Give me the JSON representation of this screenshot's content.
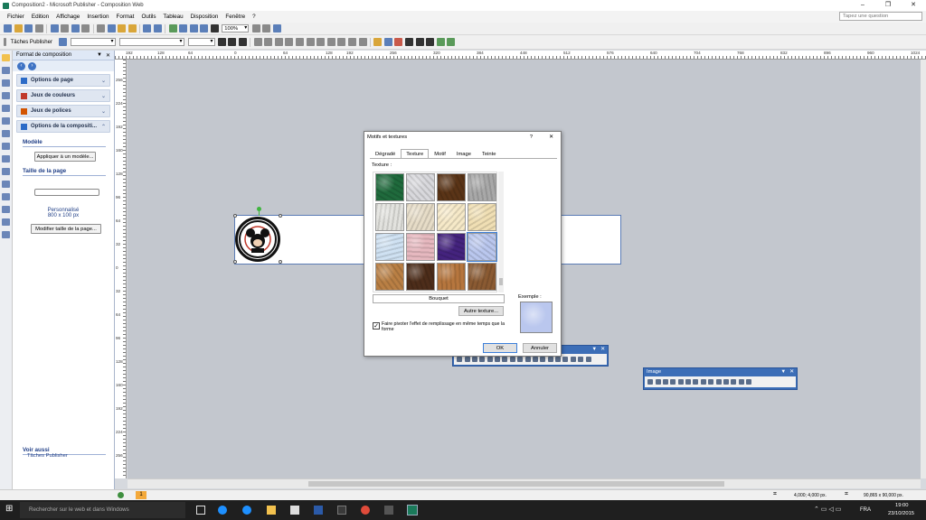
{
  "window": {
    "title": "Composition2 - Microsoft Publisher - Composition Web",
    "controls": [
      "–",
      "❐",
      "✕"
    ]
  },
  "menubar": {
    "items": [
      "Fichier",
      "Edition",
      "Affichage",
      "Insertion",
      "Format",
      "Outils",
      "Tableau",
      "Disposition",
      "Fenêtre",
      "?"
    ],
    "help_placeholder": "Tapez une question"
  },
  "toolbar": {
    "zoom": "100%",
    "task_pane_label": "Tâches Publisher"
  },
  "task_pane": {
    "title": "Format de composition",
    "sections": [
      {
        "label": "Options de page"
      },
      {
        "label": "Jeux de couleurs"
      },
      {
        "label": "Jeux de polices"
      },
      {
        "label": "Options de la compositi..."
      }
    ],
    "model_title": "Modèle",
    "apply_model_button": "Appliquer à un modèle...",
    "page_size_title": "Taille de la page",
    "size_name": "Personnalisé",
    "size_value": "800 x 100 px",
    "modify_size_button": "Modifier taille de la page...",
    "see_also_title": "Voir aussi",
    "see_also_link": "Tâches Publisher"
  },
  "ruler_h": [
    "192",
    "128",
    "64",
    "0",
    "64",
    "128",
    "192",
    "256",
    "320",
    "384",
    "448",
    "512",
    "576",
    "640",
    "704",
    "768",
    "832",
    "896",
    "960",
    "1024",
    "1088",
    "1152",
    "1216",
    "1280",
    "1344"
  ],
  "ruler_v": [
    "256",
    "224",
    "192",
    "160",
    "128",
    "96",
    "64",
    "32",
    "0",
    "32",
    "64",
    "96",
    "128",
    "160",
    "192",
    "224",
    "256",
    "288"
  ],
  "dialog": {
    "title": "Motifs et textures",
    "help": "?",
    "close": "✕",
    "tabs": [
      "Dégradé",
      "Texture",
      "Motif",
      "Image",
      "Teinte"
    ],
    "active_tab": "Texture",
    "texture_label": "Texture :",
    "selected_texture": "Bouquet",
    "other_texture_button": "Autre texture...",
    "example_label": "Exemple :",
    "rotate_checkbox": "Faire pivoter l'effet de remplissage en même temps que la forme",
    "rotate_checked": true,
    "ok_button": "OK",
    "cancel_button": "Annuler",
    "swatches": [
      {
        "name": "Marbre vert",
        "color": "#1f6a3c"
      },
      {
        "name": "Marbre blanc",
        "color": "#d8d8dc"
      },
      {
        "name": "Marbre marron",
        "color": "#5a3417"
      },
      {
        "name": "Granit",
        "color": "#a8a8a8"
      },
      {
        "name": "Papier",
        "color": "#e2e2de"
      },
      {
        "name": "Papyrus",
        "color": "#e6dcc7"
      },
      {
        "name": "Parchemin",
        "color": "#f6e9c8"
      },
      {
        "name": "Sable",
        "color": "#f0dfb4"
      },
      {
        "name": "Gouttes",
        "color": "#cfe1f2"
      },
      {
        "name": "Rose",
        "color": "#e6b8bf"
      },
      {
        "name": "Violet",
        "color": "#44237e"
      },
      {
        "name": "Bouquet",
        "color": "#bac7ee"
      },
      {
        "name": "Liège",
        "color": "#b97f44"
      },
      {
        "name": "Noyer",
        "color": "#4d2d1a"
      },
      {
        "name": "Chêne",
        "color": "#b6763e"
      },
      {
        "name": "Bois",
        "color": "#8a5a32"
      }
    ]
  },
  "float_toolbar_image": {
    "title": "Image"
  },
  "statusbar": {
    "page_number": "1",
    "position": "4,000; 4,000 px.",
    "size": "90,865 x 90,000 px."
  },
  "taskbar": {
    "search_placeholder": "Rechercher sur le web et dans Windows",
    "language": "FRA",
    "time": "19:00",
    "date": "23/10/2015"
  }
}
